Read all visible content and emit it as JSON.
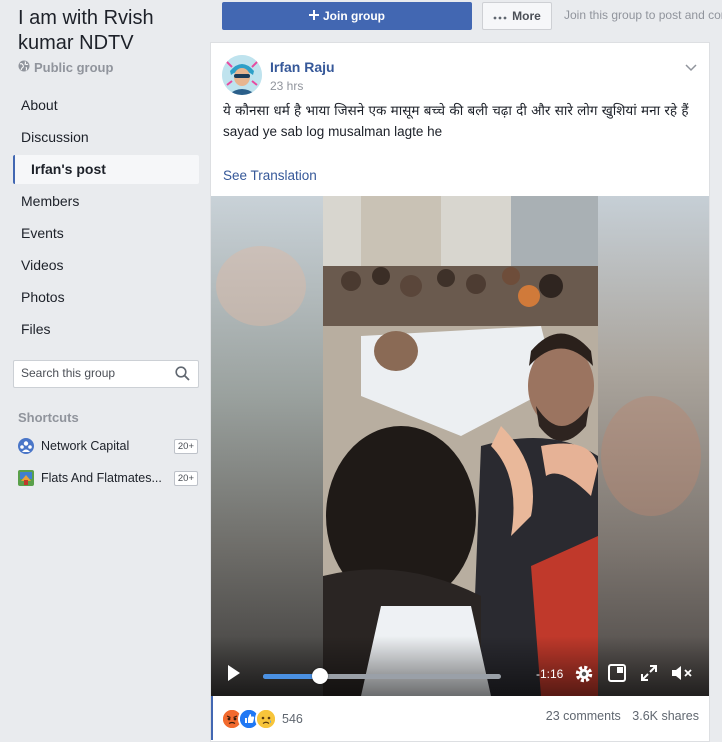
{
  "group": {
    "title": "I am with Rvish kumar NDTV",
    "type": "Public group"
  },
  "nav": [
    {
      "label": "About"
    },
    {
      "label": "Discussion"
    },
    {
      "label": "Irfan's post"
    },
    {
      "label": "Members"
    },
    {
      "label": "Events"
    },
    {
      "label": "Videos"
    },
    {
      "label": "Photos"
    },
    {
      "label": "Files"
    }
  ],
  "search": {
    "placeholder": "Search this group"
  },
  "shortcuts": {
    "title": "Shortcuts",
    "items": [
      {
        "name": "Network Capital",
        "badge": "20+"
      },
      {
        "name": "Flats And Flatmates...",
        "badge": "20+"
      }
    ]
  },
  "actions": {
    "join_label": "Join group",
    "more_label": "More",
    "hint": "Join this group to post and comment"
  },
  "post": {
    "author": "Irfan Raju",
    "time": "23 hrs",
    "text_line1": "ये कौनसा धर्म है भाया जिसने एक मासूम बच्चे की बली चढ़ा दी और सारे लोग खुशियां मना रहे हैं",
    "text_line2": "sayad ye sab log musalman lagte he",
    "see_translation": "See Translation"
  },
  "video": {
    "time_remaining": "-1:16",
    "progress": 0.24
  },
  "footer": {
    "reaction_count": "546",
    "comments": "23 comments",
    "shares": "3.6K shares"
  },
  "colors": {
    "accent": "#4267b2",
    "link": "#365899",
    "progress": "#4a90e2"
  }
}
